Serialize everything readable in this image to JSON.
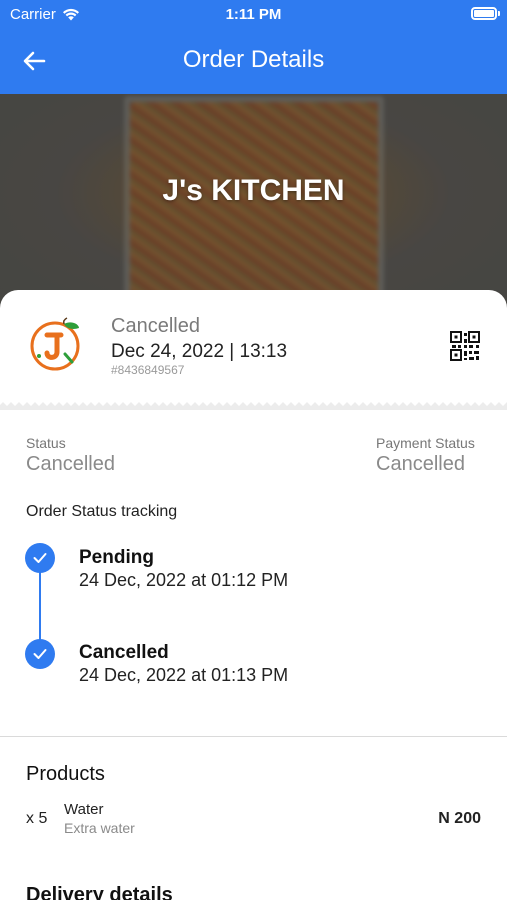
{
  "status_bar": {
    "carrier": "Carrier",
    "time": "1:11 PM"
  },
  "nav": {
    "title": "Order Details"
  },
  "hero": {
    "restaurant_name": "J's KITCHEN"
  },
  "order": {
    "status": "Cancelled",
    "datetime": "Dec 24, 2022 | 13:13",
    "order_id": "#8436849567"
  },
  "summary": {
    "status_label": "Status",
    "status_value": "Cancelled",
    "payment_label": "Payment Status",
    "payment_value": "Cancelled"
  },
  "tracking": {
    "title": "Order Status tracking",
    "steps": [
      {
        "label": "Pending",
        "time": "24 Dec, 2022 at 01:12 PM"
      },
      {
        "label": "Cancelled",
        "time": "24 Dec, 2022 at 01:13 PM"
      }
    ]
  },
  "products": {
    "title": "Products",
    "items": [
      {
        "qty": "x 5",
        "name": "Water",
        "extra": "Extra water",
        "price": "N 200"
      }
    ]
  },
  "delivery": {
    "title": "Delivery details"
  },
  "colors": {
    "primary": "#2f7bf0",
    "logo_orange": "#e8701d",
    "logo_green": "#2e9e3a"
  },
  "icons": [
    "wifi-icon",
    "battery-icon",
    "back-arrow-icon",
    "qr-code-icon",
    "check-icon"
  ]
}
